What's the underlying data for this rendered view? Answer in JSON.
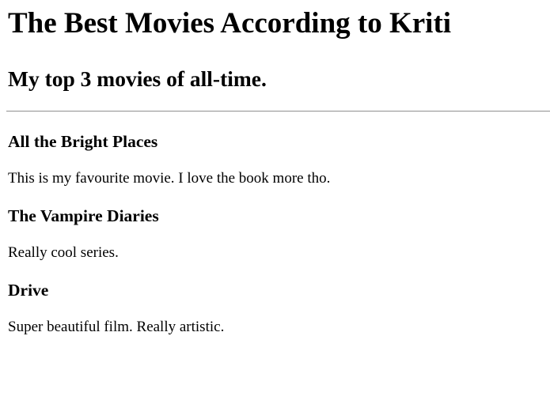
{
  "page": {
    "title": "The Best Movies According to Kriti",
    "subtitle": "My top 3 movies of all-time."
  },
  "movies": [
    {
      "name": "All the Bright Places",
      "description": "This is my favourite movie. I love the book more tho."
    },
    {
      "name": "The Vampire Diaries",
      "description": "Really cool series."
    },
    {
      "name": "Drive",
      "description": "Super beautiful film. Really artistic."
    }
  ]
}
